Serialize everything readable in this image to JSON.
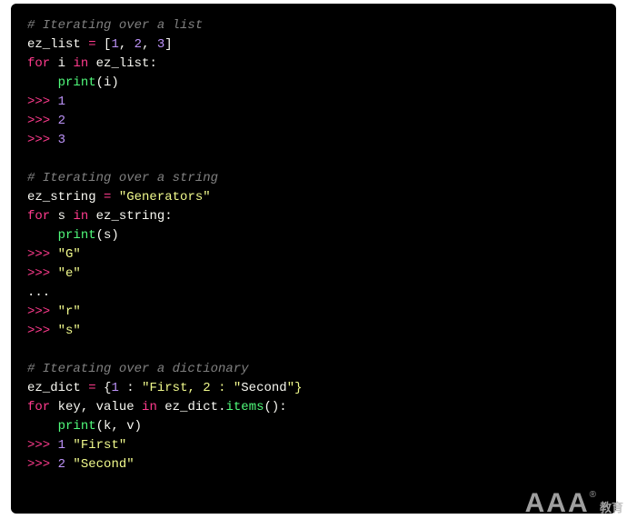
{
  "code": {
    "s1_comment": "# Iterating over a list",
    "s1_l2_a": "ez_list ",
    "s1_l2_b": "=",
    "s1_l2_c": " [",
    "s1_l2_d": "1",
    "s1_l2_e": ", ",
    "s1_l2_f": "2",
    "s1_l2_g": ", ",
    "s1_l2_h": "3",
    "s1_l2_i": "]",
    "s1_l3_a": "for",
    "s1_l3_b": " i ",
    "s1_l3_c": "in",
    "s1_l3_d": " ez_list:",
    "s1_l4_a": "    ",
    "s1_l4_b": "print",
    "s1_l4_c": "(i)",
    "s1_o1_p": ">>>",
    "s1_o1_v": " 1",
    "s1_o2_p": ">>>",
    "s1_o2_v": " 2",
    "s1_o3_p": ">>>",
    "s1_o3_v": " 3",
    "s2_comment": "# Iterating over a string",
    "s2_l2_a": "ez_string ",
    "s2_l2_b": "=",
    "s2_l2_c": " ",
    "s2_l2_d": "\"Generators\"",
    "s2_l3_a": "for",
    "s2_l3_b": " s ",
    "s2_l3_c": "in",
    "s2_l3_d": " ez_string:",
    "s2_l4_a": "    ",
    "s2_l4_b": "print",
    "s2_l4_c": "(s)",
    "s2_o1_p": ">>>",
    "s2_o1_v": " \"G\"",
    "s2_o2_p": ">>>",
    "s2_o2_v": " \"e\"",
    "s2_o3": "...",
    "s2_o4_p": ">>>",
    "s2_o4_v": " \"r\"",
    "s2_o5_p": ">>>",
    "s2_o5_v": " \"s\"",
    "s3_comment": "# Iterating over a dictionary",
    "s3_l2_a": "ez_dict ",
    "s3_l2_b": "=",
    "s3_l2_c": " {",
    "s3_l2_d": "1",
    "s3_l2_e": " : ",
    "s3_l2_f": "\"First, 2 : \"",
    "s3_l2_g": "Second",
    "s3_l2_h": "\"}",
    "s3_l3_a": "for",
    "s3_l3_b": " key, value ",
    "s3_l3_c": "in",
    "s3_l3_d": " ez_dict",
    "s3_l3_e": ".",
    "s3_l3_f": "items",
    "s3_l3_g": "():",
    "s3_l4_a": "    ",
    "s3_l4_b": "print",
    "s3_l4_c": "(k, v)",
    "s3_o1_p": ">>>",
    "s3_o1_n": " 1",
    "s3_o1_v": " \"First\"",
    "s3_o2_p": ">>>",
    "s3_o2_n": " 2",
    "s3_o2_v": " \"Second\""
  },
  "watermark": {
    "aaa": "AAA",
    "reg": "®",
    "cn": "教育"
  }
}
